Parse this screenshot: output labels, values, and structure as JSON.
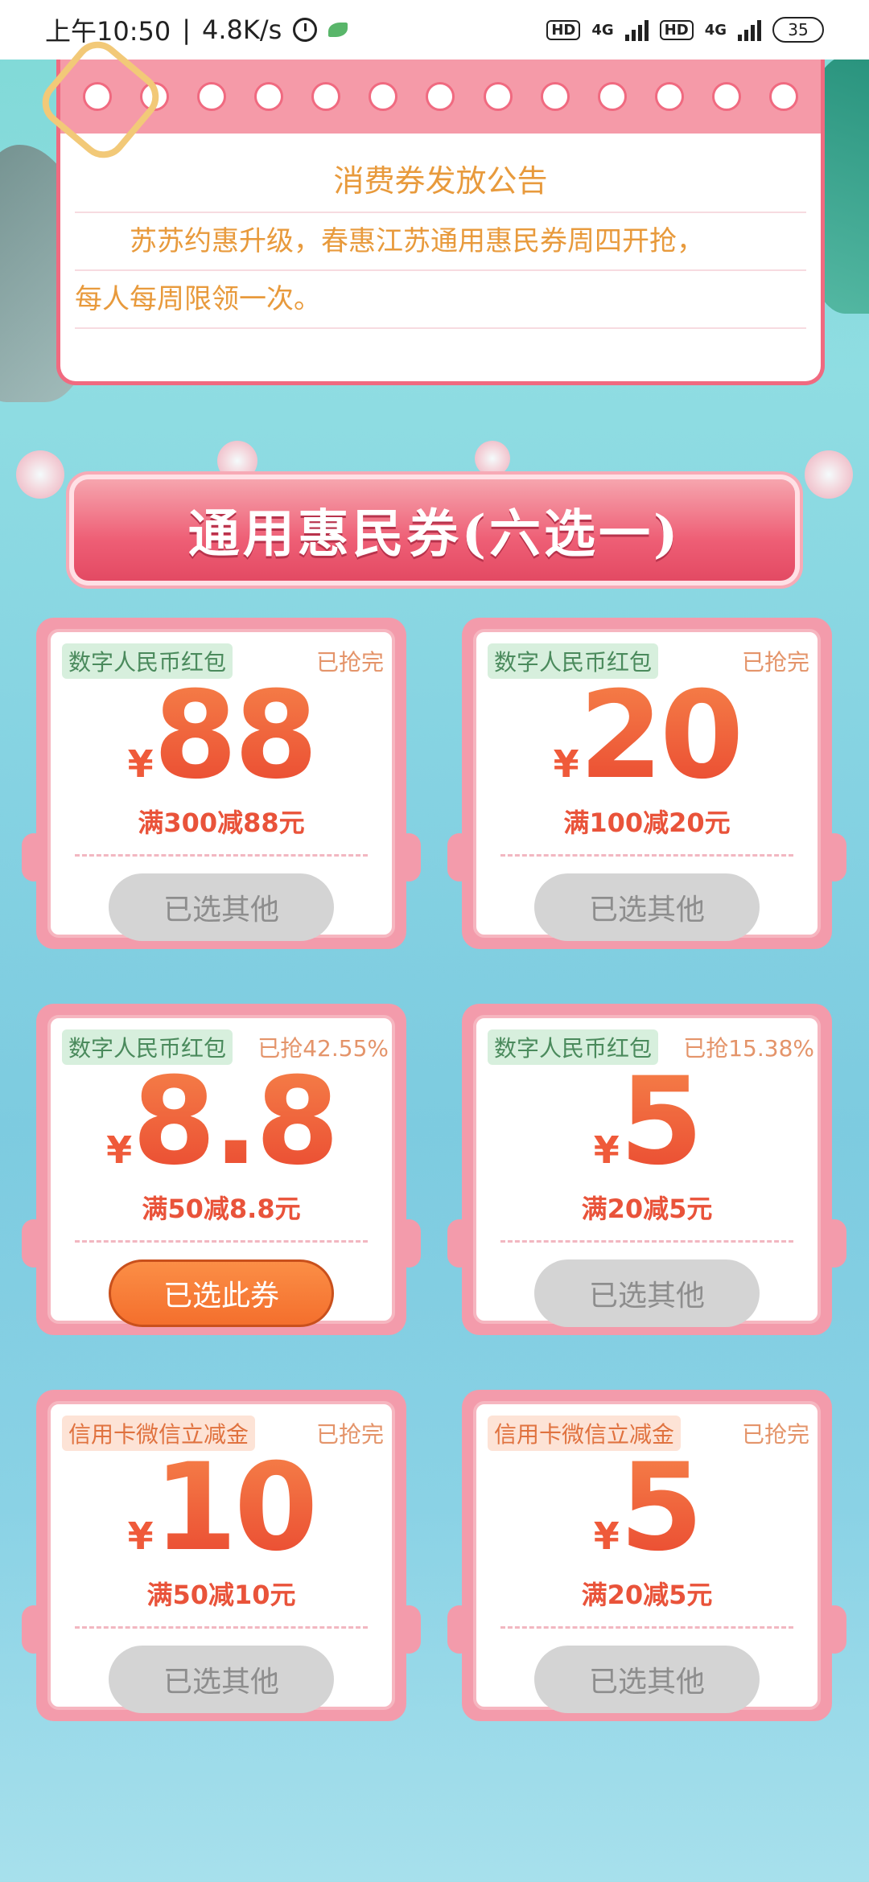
{
  "status_bar": {
    "time": "上午10:50",
    "speed": "4.8K/s",
    "hd1": "HD",
    "net1": "4G",
    "hd2": "HD",
    "net2": "4G",
    "battery": "35"
  },
  "notice": {
    "title": "消费券发放公告",
    "line1": "苏苏约惠升级，春惠江苏通用惠民券周四开抢，",
    "line2": "每人每周限领一次。"
  },
  "banner": {
    "title": "通用惠民券(六选一)"
  },
  "currency": "¥",
  "coupons": [
    {
      "tag": "数字人民币红包",
      "status": "已抢完",
      "amount": "88",
      "condition": "满300减88元",
      "button": "已选其他"
    },
    {
      "tag": "数字人民币红包",
      "status": "已抢完",
      "amount": "20",
      "condition": "满100减20元",
      "button": "已选其他"
    },
    {
      "tag": "数字人民币红包",
      "status": "已抢42.55%",
      "amount": "8.8",
      "condition": "满50减8.8元",
      "button": "已选此券"
    },
    {
      "tag": "数字人民币红包",
      "status": "已抢15.38%",
      "amount": "5",
      "condition": "满20减5元",
      "button": "已选其他"
    },
    {
      "tag": "信用卡微信立减金",
      "status": "已抢完",
      "amount": "10",
      "condition": "满50减10元",
      "button": "已选其他"
    },
    {
      "tag": "信用卡微信立减金",
      "status": "已抢完",
      "amount": "5",
      "condition": "满20减5元",
      "button": "已选其他"
    }
  ]
}
